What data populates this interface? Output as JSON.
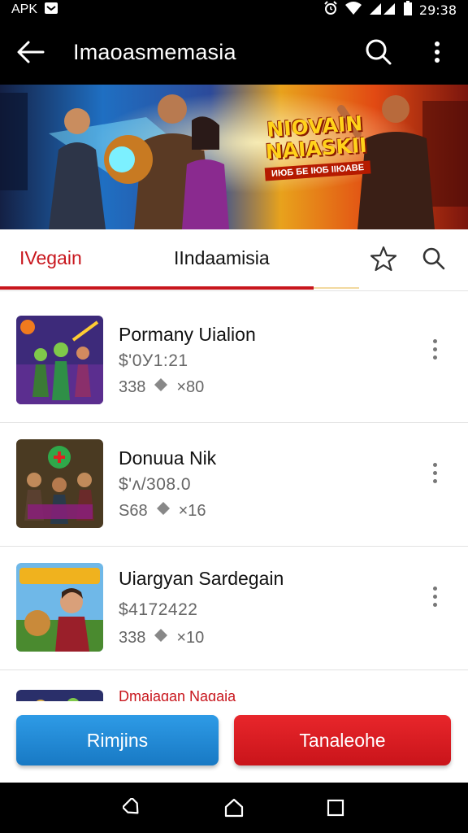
{
  "status_bar": {
    "left_label": "APK",
    "time": "29:38"
  },
  "app_bar": {
    "title": "Imaoasmemasia"
  },
  "banner": {
    "title_line1": "NIOVAIN",
    "title_line2": "NAIASKII",
    "subtitle": "ИЮБ БЕ ІЮБ ІІЮАВЕ"
  },
  "tabs": [
    {
      "label": "IVegain",
      "active": true
    },
    {
      "label": "IIndaamisia",
      "active": false
    }
  ],
  "items": [
    {
      "title": "Pormany Uialion",
      "price": "$'0У1:21",
      "meta_left": "338",
      "meta_right": "×80",
      "thumb_icon": "game-art-heroes"
    },
    {
      "title": "Donuua Nik",
      "price": "$'ᴧ/308.0",
      "meta_left": "S68",
      "meta_right": "×16",
      "thumb_icon": "game-art-battle"
    },
    {
      "title": "Uiargyan Sardegain",
      "price": "$4172422",
      "meta_left": "338",
      "meta_right": "×10",
      "thumb_icon": "game-art-adventure"
    },
    {
      "title": "Dmaiagan Nagaia",
      "thumb_icon": "game-art-fantasy"
    }
  ],
  "buttons": {
    "primary": "Rimjins",
    "secondary": "Tanaleohe"
  },
  "colors": {
    "accent_red": "#c8161d",
    "button_blue": "#1e88d6",
    "button_red": "#dc1c22"
  }
}
